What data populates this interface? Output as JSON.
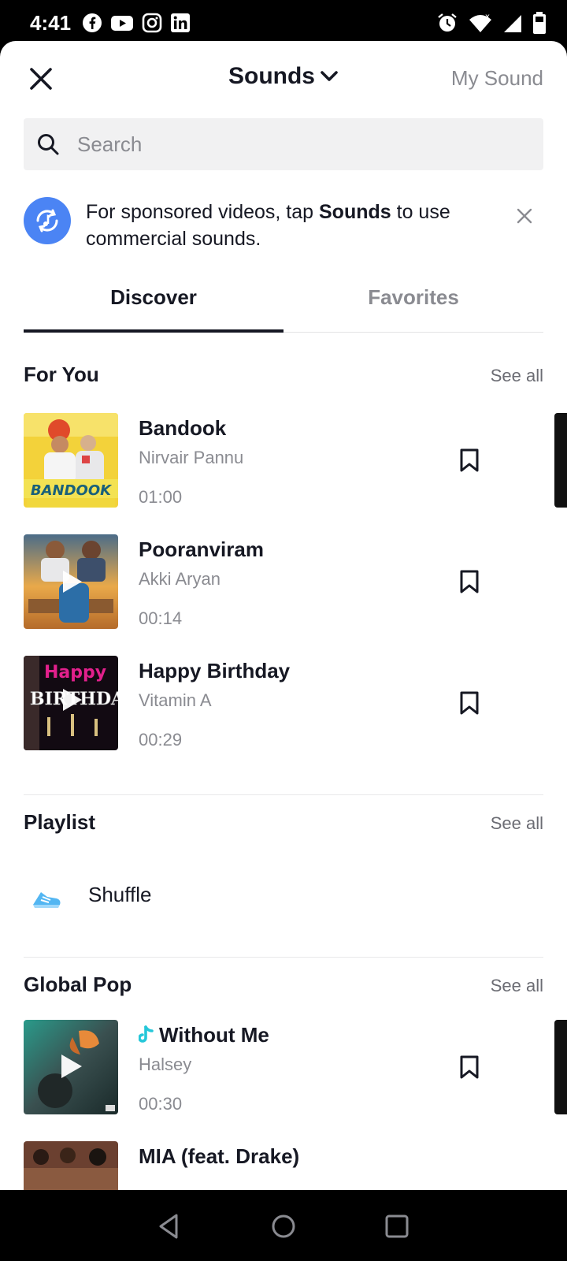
{
  "status_bar": {
    "time": "4:41",
    "app_icons": [
      "facebook-icon",
      "youtube-icon",
      "instagram-icon",
      "linkedin-icon"
    ],
    "right_icons": [
      "alarm-icon",
      "wifi-icon",
      "signal-icon",
      "battery-icon"
    ]
  },
  "header": {
    "title": "Sounds",
    "my_sound_label": "My Sound"
  },
  "search": {
    "placeholder": "Search"
  },
  "banner": {
    "text_before": "For sponsored videos, tap ",
    "text_bold": "Sounds",
    "text_after": " to use commercial sounds."
  },
  "tabs": [
    {
      "label": "Discover",
      "active": true
    },
    {
      "label": "Favorites",
      "active": false
    }
  ],
  "sections": {
    "for_you": {
      "title": "For You",
      "see_all": "See all",
      "tracks": [
        {
          "title": "Bandook",
          "artist": "Nirvair Pannu",
          "duration": "01:00"
        },
        {
          "title": "Pooranviram",
          "artist": "Akki Aryan",
          "duration": "00:14"
        },
        {
          "title": "Happy Birthday",
          "artist": "Vitamin A",
          "duration": "00:29"
        }
      ]
    },
    "playlist": {
      "title": "Playlist",
      "see_all": "See all",
      "items": [
        {
          "label": "Shuffle"
        }
      ]
    },
    "global_pop": {
      "title": "Global Pop",
      "see_all": "See all",
      "tracks": [
        {
          "title": "Without Me",
          "artist": "Halsey",
          "duration": "00:30"
        },
        {
          "title": "MIA (feat. Drake)"
        }
      ]
    }
  },
  "colors": {
    "accent_blue": "#4b84f4",
    "text_primary": "#161823",
    "text_secondary": "#8a8b91",
    "tiktok_cyan": "#25c7d9"
  }
}
